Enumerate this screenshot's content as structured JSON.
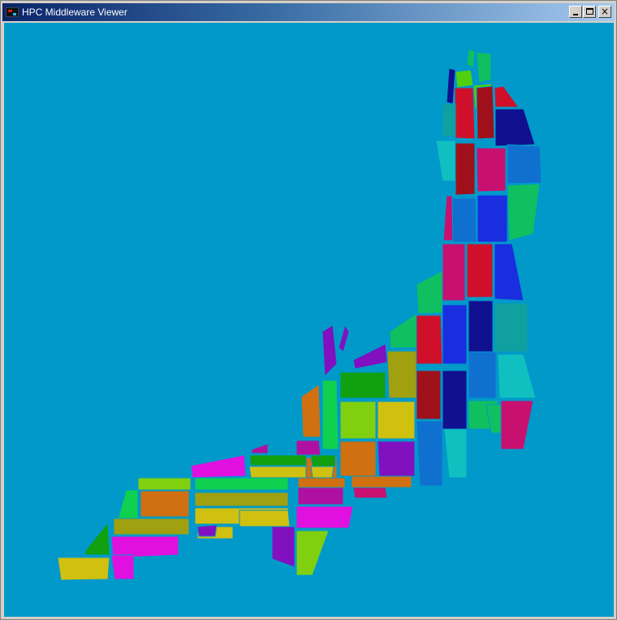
{
  "window": {
    "title": "HPC Middleware Viewer",
    "minimize_label": "",
    "maximize_label": "",
    "close_label": "×"
  },
  "colors": {
    "canvas_background": "#0099c9",
    "titlebar_start": "#0a246a",
    "titlebar_end": "#a6caf0"
  },
  "map": {
    "description_icon": "domain-decomposition-map",
    "partition_colors": [
      "#d0102a",
      "#a0101a",
      "#101090",
      "#1070d0",
      "#1a2ee0",
      "#10c060",
      "#c81070",
      "#d0c010",
      "#e010e0",
      "#50d010",
      "#d07010",
      "#8010c0",
      "#10a0a0",
      "#60e060",
      "#a0a010"
    ]
  }
}
